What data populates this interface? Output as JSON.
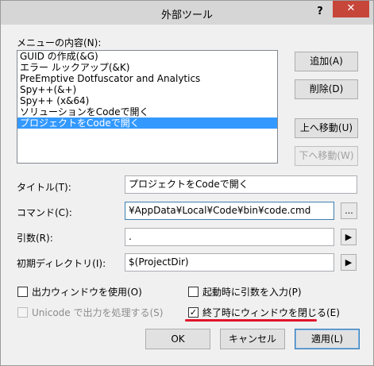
{
  "window": {
    "title": "外部ツール",
    "help_glyph": "?",
    "close_glyph": "✕"
  },
  "menu_contents": {
    "label": "メニューの内容(N):",
    "items": [
      "GUID の作成(&G)",
      "エラー ルックアップ(&K)",
      "PreEmptive Dotfuscator and Analytics",
      "Spy++(&+)",
      "Spy++ (x&64)",
      "ソリューションをCodeで開く",
      "プロジェクトをCodeで開く"
    ],
    "selected_index": 6
  },
  "side_buttons": {
    "add": "追加(A)",
    "delete": "削除(D)",
    "move_up": "上へ移動(U)",
    "move_down": "下へ移動(W)"
  },
  "fields": {
    "title_label": "タイトル(T):",
    "title_value": "プロジェクトをCodeで開く",
    "command_label": "コマンド(C):",
    "command_value": "¥AppData¥Local¥Code¥bin¥code.cmd",
    "command_browse": "...",
    "args_label": "引数(R):",
    "args_value": ".",
    "args_arrow": "▶",
    "initdir_label": "初期ディレクトリ(I):",
    "initdir_value": "$(ProjectDir)",
    "initdir_arrow": "▶"
  },
  "options": {
    "use_output_window": {
      "label": "出力ウィンドウを使用(O)",
      "checked": false,
      "enabled": true
    },
    "prompt_args": {
      "label": "起動時に引数を入力(P)",
      "checked": false,
      "enabled": true
    },
    "unicode_output": {
      "label": "Unicode で出力を処理する(S)",
      "checked": false,
      "enabled": false
    },
    "close_on_exit": {
      "label": "終了時にウィンドウを閉じる(E)",
      "checked": true,
      "enabled": true
    }
  },
  "bottom_buttons": {
    "ok": "OK",
    "cancel": "キャンセル",
    "apply": "適用(L)"
  },
  "colors": {
    "selection": "#3399ff",
    "annotation_underline": "#e0142d",
    "close_button": "#c7463a"
  }
}
